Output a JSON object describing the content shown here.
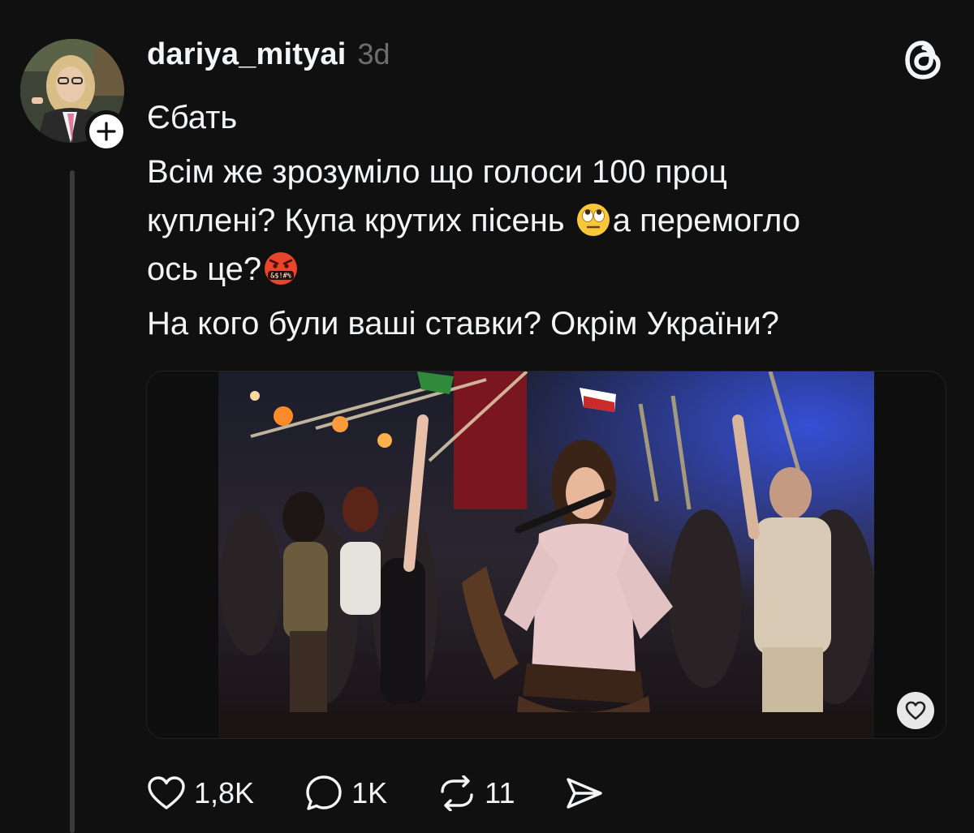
{
  "post": {
    "username": "dariya_mityai",
    "timestamp": "3d",
    "lines": [
      "Єбать",
      "Всім же зрозуміло що голоси 100 проц",
      "куплені? Купа крутих пісень",
      "а перемогло",
      "ось це?",
      "На кого були ваші ставки? Окрім України?"
    ],
    "emojis": [
      "face-with-rolling-eyes",
      "face-with-symbols-on-mouth"
    ]
  },
  "actions": {
    "likes": "1,8K",
    "replies": "1K",
    "reposts": "11"
  },
  "icons": {
    "avatar": "profile-photo",
    "follow": "plus-icon",
    "app": "threads-logo-icon",
    "like": "heart-icon",
    "reply": "speech-bubble-icon",
    "repost": "repost-icon",
    "share": "send-icon",
    "media_like": "heart-icon"
  },
  "colors": {
    "background": "#101010",
    "text": "#f3f5f7",
    "muted": "#6d6d6d",
    "thread_line": "#3a3a3a"
  }
}
